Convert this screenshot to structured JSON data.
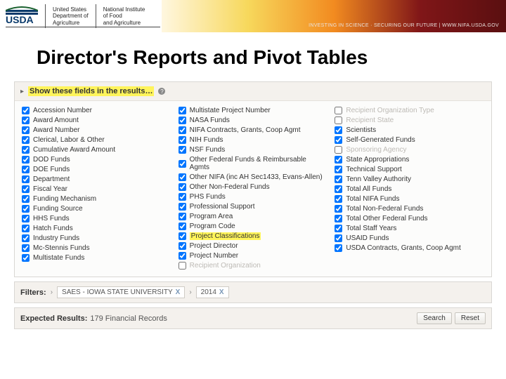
{
  "header": {
    "dept1_line1": "United States",
    "dept1_line2": "Department of",
    "dept1_line3": "Agriculture",
    "dept2_line1": "National Institute",
    "dept2_line2": "of Food",
    "dept2_line3": "and Agriculture",
    "tagline": "INVESTING IN SCIENCE · SECURING OUR FUTURE | WWW.NIFA.USDA.GOV"
  },
  "page_title": "Director's Reports and Pivot Tables",
  "fields_panel": {
    "title": "Show these fields in the results…",
    "help_icon": "?"
  },
  "columns": {
    "c1": [
      {
        "label": "Accession Number",
        "checked": true
      },
      {
        "label": "Award Amount",
        "checked": true
      },
      {
        "label": "Award Number",
        "checked": true
      },
      {
        "label": "Clerical, Labor & Other",
        "checked": true
      },
      {
        "label": "Cumulative Award Amount",
        "checked": true
      },
      {
        "label": "DOD Funds",
        "checked": true
      },
      {
        "label": "DOE Funds",
        "checked": true
      },
      {
        "label": "Department",
        "checked": true
      },
      {
        "label": "Fiscal Year",
        "checked": true
      },
      {
        "label": "Funding Mechanism",
        "checked": true
      },
      {
        "label": "Funding Source",
        "checked": true
      },
      {
        "label": "HHS Funds",
        "checked": true
      },
      {
        "label": "Hatch Funds",
        "checked": true
      },
      {
        "label": "Industry Funds",
        "checked": true
      },
      {
        "label": "Mc-Stennis Funds",
        "checked": true
      },
      {
        "label": "Multistate Funds",
        "checked": true
      }
    ],
    "c2": [
      {
        "label": "Multistate Project Number",
        "checked": true
      },
      {
        "label": "NASA Funds",
        "checked": true
      },
      {
        "label": "NIFA Contracts, Grants, Coop Agmt",
        "checked": true
      },
      {
        "label": "NIH Funds",
        "checked": true
      },
      {
        "label": "NSF Funds",
        "checked": true
      },
      {
        "label": "Other Federal Funds & Reimbursable Agmts",
        "checked": true
      },
      {
        "label": "Other NIFA (inc AH Sec1433, Evans-Allen)",
        "checked": true
      },
      {
        "label": "Other Non-Federal Funds",
        "checked": true
      },
      {
        "label": "PHS Funds",
        "checked": true
      },
      {
        "label": "Professional Support",
        "checked": true
      },
      {
        "label": "Program Area",
        "checked": true
      },
      {
        "label": "Program Code",
        "checked": true
      },
      {
        "label": "Project Classifications",
        "checked": true,
        "hl": true
      },
      {
        "label": "Project Director",
        "checked": true
      },
      {
        "label": "Project Number",
        "checked": true
      },
      {
        "label": "Recipient Organization",
        "checked": false
      }
    ],
    "c3": [
      {
        "label": "Recipient Organization Type",
        "checked": false
      },
      {
        "label": "Recipient State",
        "checked": false
      },
      {
        "label": "Scientists",
        "checked": true
      },
      {
        "label": "Self-Generated Funds",
        "checked": true
      },
      {
        "label": "Sponsoring Agency",
        "checked": false
      },
      {
        "label": "State Appropriations",
        "checked": true
      },
      {
        "label": "Technical Support",
        "checked": true
      },
      {
        "label": "Tenn Valley Authority",
        "checked": true
      },
      {
        "label": "Total All Funds",
        "checked": true
      },
      {
        "label": "Total NIFA Funds",
        "checked": true
      },
      {
        "label": "Total Non-Federal Funds",
        "checked": true
      },
      {
        "label": "Total Other Federal Funds",
        "checked": true
      },
      {
        "label": "Total Staff Years",
        "checked": true
      },
      {
        "label": "USAID Funds",
        "checked": true
      },
      {
        "label": "USDA Contracts, Grants, Coop Agmt",
        "checked": true
      }
    ]
  },
  "filters": {
    "label": "Filters:",
    "chips": [
      {
        "text": "SAES - IOWA STATE UNIVERSITY",
        "close": "X"
      },
      {
        "text": "2014",
        "close": "X"
      }
    ]
  },
  "results": {
    "label": "Expected Results:",
    "value": "179 Financial Records",
    "search_btn": "Search",
    "reset_btn": "Reset"
  }
}
